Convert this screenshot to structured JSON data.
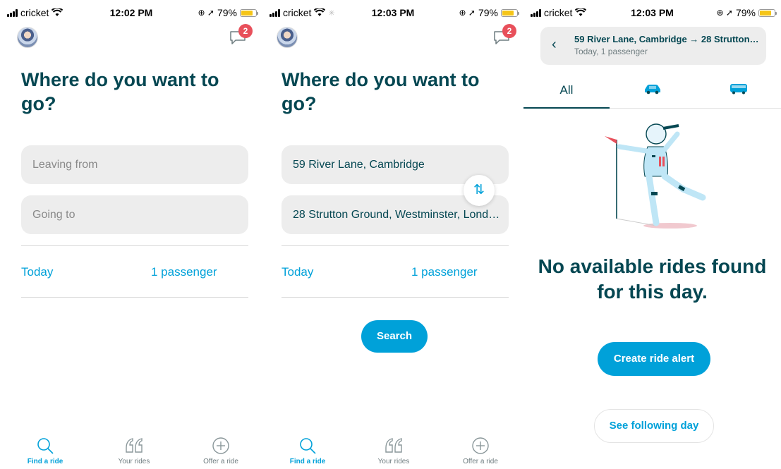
{
  "screens": [
    {
      "status": {
        "carrier": "cricket",
        "time": "12:02 PM",
        "battery": "79%"
      },
      "messages": {
        "badge": "2"
      },
      "headline": "Where do you want to go?",
      "from": {
        "placeholder": "Leaving from",
        "value": ""
      },
      "to": {
        "placeholder": "Going to",
        "value": ""
      },
      "date_label": "Today",
      "passengers_label": "1 passenger"
    },
    {
      "status": {
        "carrier": "cricket",
        "time": "12:03 PM",
        "battery": "79%"
      },
      "messages": {
        "badge": "2"
      },
      "headline": "Where do you want to go?",
      "from": {
        "placeholder": "",
        "value": "59 River Lane, Cambridge"
      },
      "to": {
        "placeholder": "",
        "value": "28 Strutton Ground, Westminster, London..."
      },
      "date_label": "Today",
      "passengers_label": "1 passenger",
      "search_label": "Search"
    },
    {
      "status": {
        "carrier": "cricket",
        "time": "12:03 PM",
        "battery": "79%"
      },
      "summary": {
        "route": "59 River Lane, Cambridge → 28 Strutton Gro...",
        "meta": "Today, 1 passenger"
      },
      "filters": {
        "all_label": "All",
        "car_icon": "car-icon",
        "bus_icon": "bus-icon",
        "selected": "All"
      },
      "empty_title": "No available rides found for this day.",
      "create_alert_label": "Create ride alert",
      "following_day_label": "See following day"
    }
  ],
  "tabbar": {
    "find": "Find a ride",
    "yours": "Your rides",
    "offer": "Offer a ride"
  },
  "colors": {
    "accent": "#00a1d9",
    "heading": "#054752",
    "badge": "#e8505b",
    "field_bg": "#ededed"
  }
}
